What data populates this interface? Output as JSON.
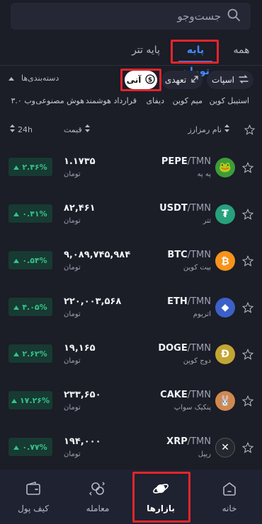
{
  "search": {
    "placeholder": "جست‌وجو"
  },
  "quote_tabs": [
    {
      "label": "همه",
      "active": false
    },
    {
      "label": "پایه تومان",
      "active": true
    },
    {
      "label": "پایه تتر",
      "active": false
    }
  ],
  "market_types": [
    {
      "label": "اسپات",
      "icon": "swap-icon",
      "active": false
    },
    {
      "label": "تعهدی",
      "icon": "arrows-diagonal-icon",
      "active": false
    },
    {
      "label": "آنی",
      "icon": "coin-icon",
      "active": true
    }
  ],
  "categories_dropdown": {
    "label": "دسته‌بندی‌ها"
  },
  "categories": [
    "استیبل کوین",
    "میم کوین",
    "دیفای",
    "قرارداد هوشمند",
    "هوش مصنوعی",
    "وب ۳.۰"
  ],
  "table_header": {
    "name": "نام رمزارز",
    "price": "قیمت",
    "change": "24h"
  },
  "rows": [
    {
      "symbol": "PEPE",
      "quote": "/TMN",
      "name": "په په",
      "price": "۱.۱۷۳۵",
      "unit": "تومان",
      "change": "۲.۴۶%",
      "icon_bg": "#3e9b3a",
      "icon_text": "🐸"
    },
    {
      "symbol": "USDT",
      "quote": "/TMN",
      "name": "تتر",
      "price": "۸۲,۴۶۱",
      "unit": "تومان",
      "change": "۰.۴۱%",
      "icon_bg": "#26a17b",
      "icon_text": "₮"
    },
    {
      "symbol": "BTC",
      "quote": "/TMN",
      "name": "بیت کوین",
      "price": "۹,۰۸۹,۷۴۵,۹۸۴",
      "unit": "تومان",
      "change": "۰.۵۴%",
      "icon_bg": "#f7931a",
      "icon_text": "₿"
    },
    {
      "symbol": "ETH",
      "quote": "/TMN",
      "name": "اتریوم",
      "price": "۲۲۰,۰۰۳,۵۶۸",
      "unit": "تومان",
      "change": "۴.۰۵%",
      "icon_bg": "#3b61c9",
      "icon_text": "◆"
    },
    {
      "symbol": "DOGE",
      "quote": "/TMN",
      "name": "دوج کوین",
      "price": "۱۹,۱۶۵",
      "unit": "تومان",
      "change": "۲.۶۲%",
      "icon_bg": "#c2a633",
      "icon_text": "Ð"
    },
    {
      "symbol": "CAKE",
      "quote": "/TMN",
      "name": "پنکیک سواپ",
      "price": "۲۳۳,۶۵۰",
      "unit": "تومان",
      "change": "۱۷.۲۶%",
      "icon_bg": "#d1884f",
      "icon_text": "🐰"
    },
    {
      "symbol": "XRP",
      "quote": "/TMN",
      "name": "ریپل",
      "price": "۱۹۴,۰۰۰",
      "unit": "تومان",
      "change": "۰.۷۷%",
      "icon_bg": "#23292f",
      "icon_text": "✕"
    }
  ],
  "bottom_nav": [
    {
      "label": "خانه",
      "icon": "home-icon",
      "active": false
    },
    {
      "label": "بازارها",
      "icon": "planet-icon",
      "active": true
    },
    {
      "label": "معامله",
      "icon": "exchange-icon",
      "active": false
    },
    {
      "label": "کیف پول",
      "icon": "wallet-icon",
      "active": false
    }
  ],
  "colors": {
    "accent": "#3f8cff",
    "positive": "#35c28a",
    "highlight": "#e3252b",
    "background": "#1b1d27"
  }
}
